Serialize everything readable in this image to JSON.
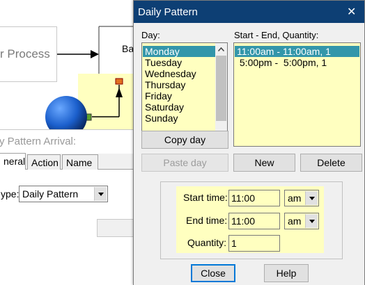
{
  "background": {
    "process_box_label": "r Process",
    "second_box_label": "Ba",
    "arrival_dialog": {
      "title": "y Pattern Arrival:",
      "tabs": [
        {
          "label": "neral"
        },
        {
          "label": "Action"
        },
        {
          "label": "Name"
        }
      ],
      "type_label": "ype:",
      "type_value": "Daily Pattern"
    }
  },
  "dialog": {
    "title": "Daily Pattern",
    "close_glyph": "✕",
    "day_label": "Day:",
    "days": [
      "Monday",
      "Tuesday",
      "Wednesday",
      "Thursday",
      "Friday",
      "Saturday",
      "Sunday"
    ],
    "selected_day": "Monday",
    "schedule_label": "Start - End, Quantity:",
    "schedule": [
      "11:00am - 11:00am, 1",
      " 5:00pm -  5:00pm, 1"
    ],
    "buttons": {
      "copy_day": "Copy day",
      "paste_day": "Paste day",
      "new": "New",
      "delete": "Delete",
      "close": "Close",
      "help": "Help"
    },
    "start_time": {
      "label": "Start time:",
      "value": "11:00",
      "ampm": "am"
    },
    "end_time": {
      "label": "End time:",
      "value": "11:00",
      "ampm": "am"
    },
    "quantity": {
      "label": "Quantity:",
      "value": "1"
    }
  },
  "colors": {
    "title_bar": "#0d3f74",
    "selection": "#3396aa",
    "highlight_yellow": "#ffffc0",
    "node_blue": "#1b5fcc"
  }
}
